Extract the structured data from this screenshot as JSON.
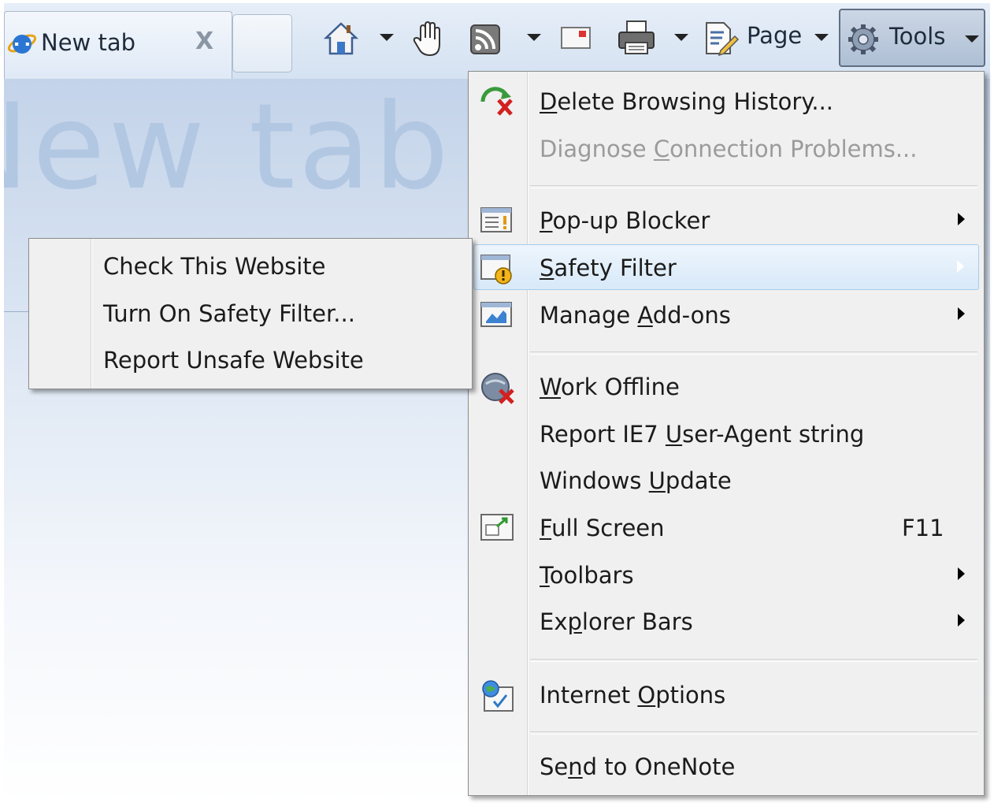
{
  "tab": {
    "title": "New tab",
    "close_glyph": "X"
  },
  "toolbar": {
    "page_label": "Page",
    "tools_label": "Tools",
    "icons": [
      "home-icon",
      "hand-icon",
      "feeds-icon",
      "mail-icon",
      "print-icon",
      "page-icon",
      "gear-icon"
    ]
  },
  "content": {
    "heading": "New tab"
  },
  "tools_menu": {
    "items": [
      {
        "pre": "",
        "u": "D",
        "post": "elete Browsing History...",
        "icon": "delete-history-icon"
      },
      {
        "pre": "Diagnose ",
        "u": "C",
        "post": "onnection Problems...",
        "disabled": true
      },
      {
        "pre": "",
        "u": "P",
        "post": "op-up Blocker",
        "icon": "popup-blocker-icon",
        "submenu": true
      },
      {
        "pre": "",
        "u": "S",
        "post": "afety Filter",
        "icon": "safety-filter-icon",
        "submenu": true,
        "highlighted": true
      },
      {
        "pre": "Manage ",
        "u": "A",
        "post": "dd-ons",
        "icon": "add-ons-icon",
        "submenu": true
      },
      {
        "pre": "",
        "u": "W",
        "post": "ork Offline",
        "icon": "work-offline-icon"
      },
      {
        "pre": "Report IE7 ",
        "u": "U",
        "post": "ser-Agent string"
      },
      {
        "pre": "Windows ",
        "u": "U",
        "post": "pdate"
      },
      {
        "pre": "",
        "u": "F",
        "post": "ull Screen",
        "icon": "full-screen-icon",
        "shortcut": "F11"
      },
      {
        "pre": "",
        "u": "T",
        "post": "oolbars",
        "submenu": true
      },
      {
        "pre": "Ex",
        "u": "p",
        "post": "lorer Bars",
        "submenu": true
      },
      {
        "pre": "Internet ",
        "u": "O",
        "post": "ptions",
        "icon": "internet-options-icon"
      },
      {
        "pre": "Se",
        "u": "n",
        "post": "d to OneNote"
      }
    ]
  },
  "safety_submenu": {
    "items": [
      "Check This Website",
      "Turn On Safety Filter...",
      "Report Unsafe Website"
    ]
  }
}
